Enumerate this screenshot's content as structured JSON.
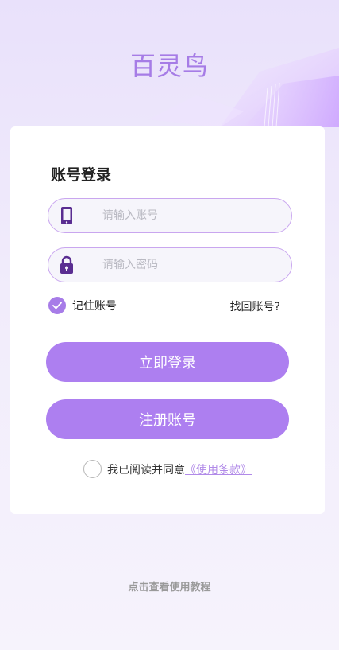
{
  "app": {
    "title": "百灵鸟"
  },
  "login": {
    "heading": "账号登录",
    "account_placeholder": "请输入账号",
    "password_placeholder": "请输入密码",
    "remember_label": "记住账号",
    "remember_checked": true,
    "find_account_label": "找回账号?",
    "login_button": "立即登录",
    "register_button": "注册账号",
    "agree_text": "我已阅读并同意",
    "terms_link": "《使用条款》",
    "agree_checked": false
  },
  "footer": {
    "tutorial_link": "点击查看使用教程"
  },
  "colors": {
    "accent": "#ad7ff0",
    "title": "#a67ce6",
    "icon": "#5a2d91",
    "field_border": "#c9a6ef"
  },
  "icons": {
    "account": "phone-icon",
    "password": "lock-icon",
    "remember": "check-icon"
  }
}
